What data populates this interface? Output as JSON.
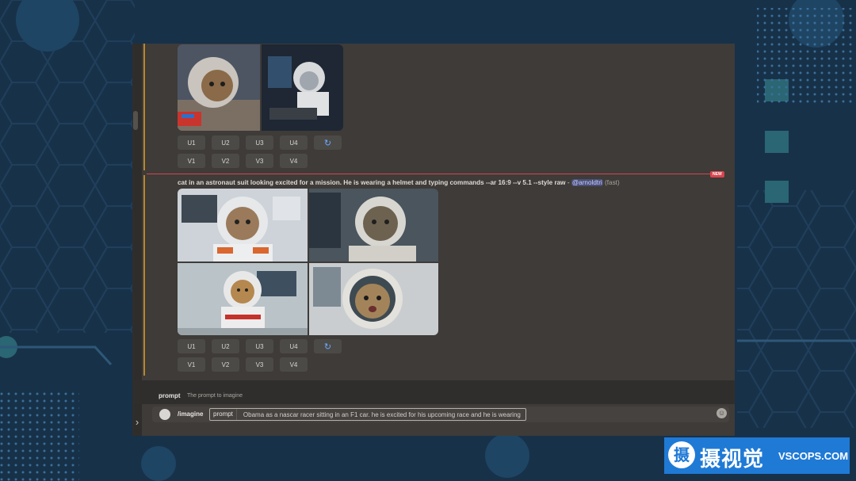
{
  "first_message": {
    "upscale_buttons": [
      "U1",
      "U2",
      "U3",
      "U4"
    ],
    "variation_buttons": [
      "V1",
      "V2",
      "V3",
      "V4"
    ],
    "reroll_icon": "refresh-icon"
  },
  "new_divider": {
    "badge": "NEW"
  },
  "second_message": {
    "prompt_text": "cat in an astronaut suit looking excited for a mission. He is wearing a helmet and typing commands --ar 16:9 --v 5.1 --style raw",
    "separator": " - ",
    "mention": "@arnoldtri",
    "speed": "(fast)",
    "upscale_buttons": [
      "U1",
      "U2",
      "U3",
      "U4"
    ],
    "variation_buttons": [
      "V1",
      "V2",
      "V3",
      "V4"
    ],
    "reroll_icon": "refresh-icon"
  },
  "command_hint": {
    "name": "prompt",
    "description": "The prompt to imagine"
  },
  "input": {
    "command": "/imagine",
    "param_name": "prompt",
    "param_value": "Obama as a nascar racer sitting in an F1 car. he is excited for his upcoming race and he is wearing",
    "emoji_icon": "smile-icon"
  },
  "watermark": {
    "logo_char": "摄",
    "chinese_text": "摄视觉",
    "english_text": "VSCOPS.COM"
  },
  "colors": {
    "background": "#173149",
    "chat_bg": "#3e3b38",
    "message_accent": "#b8862f",
    "new_divider": "#d9444e",
    "mention_bg": "#4a4f77",
    "watermark_bg": "#1f7ad6"
  }
}
